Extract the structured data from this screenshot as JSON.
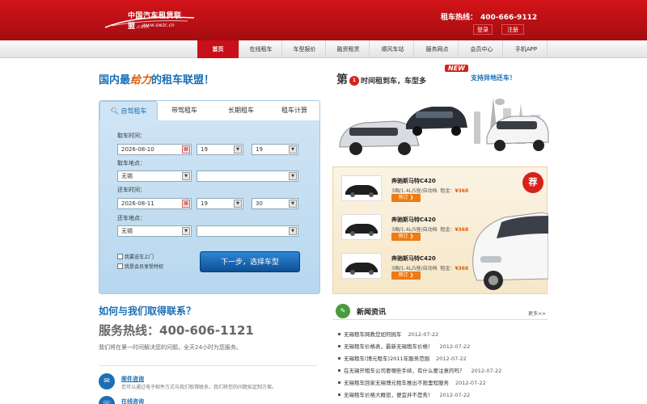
{
  "header": {
    "logo_name": "中国汽车租赁联盟",
    "logo_suffix": ".com",
    "logo_url": "www.swzc.cn",
    "hotline_label": "租车热线：",
    "hotline_number": "400-666-9112",
    "login": "登录",
    "register": "注册"
  },
  "nav": {
    "items": [
      {
        "label": "首页",
        "active": true
      },
      {
        "label": "在线租车"
      },
      {
        "label": "车型报价"
      },
      {
        "label": "融资租赁"
      },
      {
        "label": "顺风车站"
      },
      {
        "label": "服务网点"
      },
      {
        "label": "会员中心"
      },
      {
        "label": "手机APP"
      }
    ]
  },
  "slogan": {
    "pre": "国内最",
    "highlight": "给力",
    "post": "的租车联盟！"
  },
  "promo": {
    "di": "第",
    "badge": "1",
    "time_text": "时间租到车，车型多",
    "new_tag": "NEW",
    "right": "支持异地还车！"
  },
  "booking": {
    "tabs": [
      "自驾租车",
      "带驾租车",
      "长期租车",
      "租车计算"
    ],
    "pickup_time_label": "取车时间：",
    "pickup_date": "2026-08-10",
    "pickup_hour": "19",
    "pickup_min": "19",
    "pickup_place_label": "取车地点：",
    "pickup_city": "无锡",
    "return_time_label": "还车时间：",
    "return_date": "2026-08-11",
    "return_hour": "19",
    "return_min": "30",
    "return_place_label": "还车地点：",
    "return_city": "无锡",
    "opt_door": "我要送车上门",
    "opt_vip": "我是会员享受特权",
    "next_button": "下一步，选择车型"
  },
  "cars": {
    "badge": "荐",
    "items": [
      {
        "name": "奔驰斯马特C420",
        "spec": "3厢/1.4L/5座/自动档",
        "rent_label": "租金：",
        "price": "¥368",
        "book": "预订"
      },
      {
        "name": "奔驰斯马特C420",
        "spec": "3厢/1.4L/5座/自动档",
        "rent_label": "租金：",
        "price": "¥368",
        "book": "预订"
      },
      {
        "name": "奔驰斯马特C420",
        "spec": "3厢/1.4L/5座/自动档",
        "rent_label": "租金：",
        "price": "¥368",
        "book": "预订"
      }
    ]
  },
  "contact": {
    "title": "如何与我们取得联系？",
    "service": "服务热线：400-606-1121",
    "desc": "我们将在第一时间解决您的问题，全天24小时为您服务。",
    "items": [
      {
        "title": "邮件咨询",
        "desc": "您可以通过电子邮件方式与我们取得联系，我们将您的问题拟定制方案。",
        "icon": "✉"
      },
      {
        "title": "在线咨询",
        "desc": "",
        "icon": "☏"
      }
    ]
  },
  "news": {
    "title": "新闻资讯",
    "more": "更多>>",
    "items": [
      {
        "title": "无锡租车网教您如何挑车",
        "date": "2012-07-22"
      },
      {
        "title": "无锡租车价格表，最新无锡租车价格！",
        "date": "2012-07-22"
      },
      {
        "title": "无锡租车(博元租车)2011年服务范围",
        "date": "2012-07-22"
      },
      {
        "title": "在无锡开租车公司要哪些手续，有什么要注意的吗？",
        "date": "2012-07-22"
      },
      {
        "title": "无锡租车回家无锡博元租车推出不限里程服务",
        "date": "2012-07-22"
      },
      {
        "title": "无锡租车价格大概密，便宜并不是秀！",
        "date": "2012-07-22"
      }
    ]
  },
  "colors": {
    "brand_red": "#c8101a",
    "link_blue": "#1a6fb6",
    "accent_orange": "#ec7b14"
  }
}
